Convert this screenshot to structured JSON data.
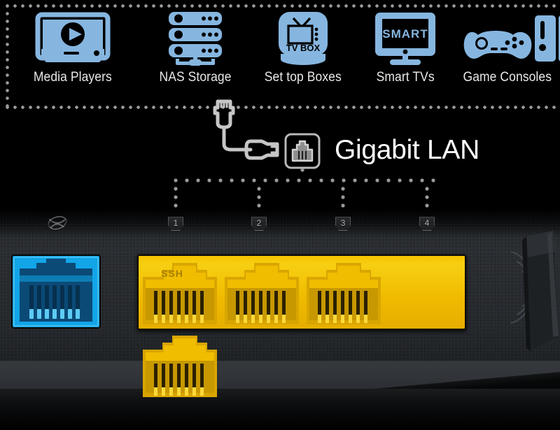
{
  "panel": {
    "border_color": "#9a9a9a",
    "icon_color": "#86b6e0",
    "devices": [
      {
        "label": "Media Players",
        "icon": "media-player-icon"
      },
      {
        "label": "NAS Storage",
        "icon": "nas-storage-icon"
      },
      {
        "label": "Set top Boxes",
        "icon": "set-top-box-icon",
        "icon_text": "TV BOX"
      },
      {
        "label": "Smart TVs",
        "icon": "smart-tv-icon",
        "icon_text": "SMART"
      },
      {
        "label": "Game Consoles",
        "icon": "game-console-icon"
      }
    ]
  },
  "connector": {
    "cable_icon": "ethernet-cable-icon",
    "badge_icon": "rj45-jack-icon",
    "heading": "Gigabit LAN",
    "heading_color": "#ffffff",
    "dot_color": "#9a9a9a"
  },
  "router": {
    "wan_marker_icon": "wan-globe-icon",
    "wan_port": {
      "name": "WAN port",
      "color": "#12a5e8"
    },
    "lan_block_color": "#f2c200",
    "lan_ports": [
      {
        "number": "1",
        "etched_text": "SSH"
      },
      {
        "number": "2",
        "etched_text": ""
      },
      {
        "number": "3",
        "etched_text": ""
      },
      {
        "number": "4",
        "etched_text": ""
      }
    ],
    "antenna": "antenna-base"
  }
}
